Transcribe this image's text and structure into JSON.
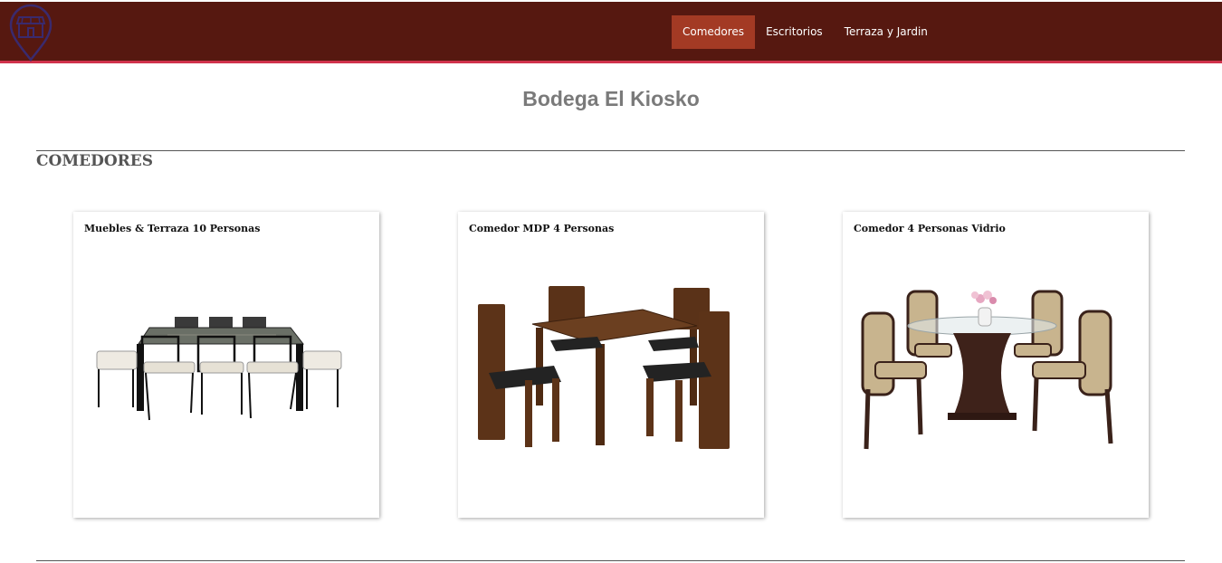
{
  "nav": {
    "logo_icon": "store-location-pin-icon",
    "items": [
      {
        "label": "Comedores",
        "active": true
      },
      {
        "label": "Escritorios",
        "active": false
      },
      {
        "label": "Terraza y Jardin",
        "active": false
      }
    ]
  },
  "page": {
    "title": "Bodega El Kiosko"
  },
  "section": {
    "heading": "COMEDORES"
  },
  "products": [
    {
      "title": "Muebles & Terraza 10 Personas",
      "image": "outdoor-dining-set-10-image"
    },
    {
      "title": "Comedor MDP 4 Personas",
      "image": "wood-dining-set-4-image"
    },
    {
      "title": "Comedor 4 Personas Vidrio",
      "image": "glass-dining-set-4-image"
    }
  ],
  "colors": {
    "header_bg": "#561810",
    "header_border": "#d0324c",
    "active_nav_bg": "#a33a24",
    "logo_stroke": "#3a2a6e"
  }
}
